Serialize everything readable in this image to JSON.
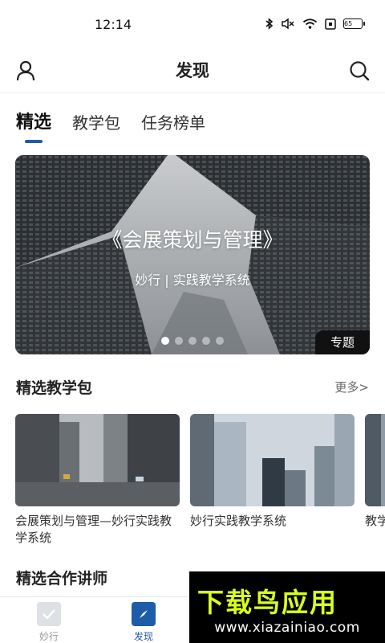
{
  "status_bar": {
    "time": "12:14",
    "battery": "65",
    "icons": [
      "bluetooth-icon",
      "mute-icon",
      "wifi-icon",
      "sim-icon",
      "battery-icon"
    ]
  },
  "header": {
    "title": "发现",
    "left_icon": "user-icon",
    "right_icon": "search-icon"
  },
  "tabs": [
    {
      "label": "精选",
      "active": true
    },
    {
      "label": "教学包",
      "active": false
    },
    {
      "label": "任务榜单",
      "active": false
    }
  ],
  "banner": {
    "title": "《会展策划与管理》",
    "subtitle": "妙行 | 实践教学系统",
    "tag": "专题",
    "dot_count": 5,
    "active_dot": 0
  },
  "featured_packages": {
    "title": "精选教学包",
    "more_label": "更多>",
    "cards": [
      {
        "title": "会展策划与管理—妙行实践教学系统"
      },
      {
        "title": "妙行实践教学系统"
      },
      {
        "title": "教学包标"
      }
    ]
  },
  "featured_lecturers": {
    "title": "精选合作讲师"
  },
  "bottom_nav": [
    {
      "label": "妙行",
      "icon": "checkbox-icon",
      "active": false
    },
    {
      "label": "发现",
      "icon": "compass-icon",
      "active": true
    }
  ],
  "colors": {
    "accent": "#1d5ca8",
    "watermark_logo": "#d9ff1f"
  },
  "watermark": {
    "logo_text": "下载鸟应用",
    "url": "www.xiazainiao.com"
  }
}
